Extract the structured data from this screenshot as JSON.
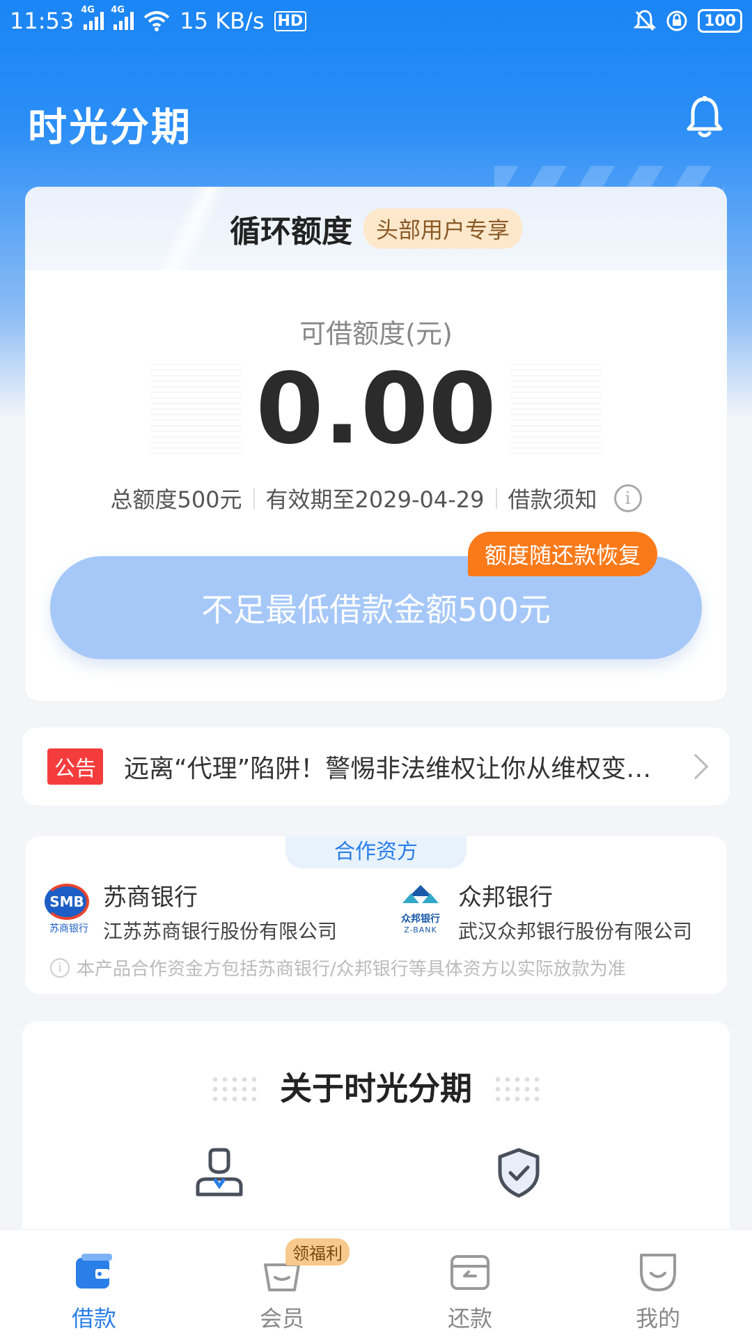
{
  "status_bar": {
    "time": "11:53",
    "net_label_1": "4G",
    "net_label_2": "4G",
    "speed": "15 KB/s",
    "hd": "HD",
    "battery": "100"
  },
  "header": {
    "app_title": "时光分期"
  },
  "credit_card": {
    "title": "循环额度",
    "vip_tag": "头部用户专享",
    "available_label": "可借额度(元)",
    "available_amount": "0.00",
    "total_quota": "总额度500元",
    "validity": "有效期至2029-04-29",
    "loan_notice": "借款须知",
    "borrow_button": "不足最低借款金额500元",
    "restore_tag": "额度随还款恢复"
  },
  "notice": {
    "tag": "公告",
    "text": "远离“代理”陷阱！警惕非法维权让你从维权变…"
  },
  "partners": {
    "tab_label": "合作资方",
    "banks": [
      {
        "logo_text": "SMB",
        "logo_sub": "苏商银行",
        "name": "苏商银行",
        "full_name": "江苏苏商银行股份有限公司"
      },
      {
        "logo_text": "众邦银行",
        "logo_sub": "Z-BANK",
        "name": "众邦银行",
        "full_name": "武汉众邦银行股份有限公司"
      }
    ],
    "note": "本产品合作资金方包括苏商银行/众邦银行等具体资方以实际放款为准"
  },
  "about": {
    "title": "关于时光分期"
  },
  "tabbar": {
    "items": [
      {
        "label": "借款",
        "icon": "wallet-icon",
        "active": true
      },
      {
        "label": "会员",
        "icon": "basket-icon",
        "active": false,
        "badge": "领福利"
      },
      {
        "label": "还款",
        "icon": "card-icon",
        "active": false
      },
      {
        "label": "我的",
        "icon": "face-icon",
        "active": false
      }
    ]
  },
  "colors": {
    "brand_blue": "#1a85f5",
    "button_disabled": "#a6c8f8",
    "orange": "#fa7a1a",
    "notice_red": "#f53c3c"
  }
}
